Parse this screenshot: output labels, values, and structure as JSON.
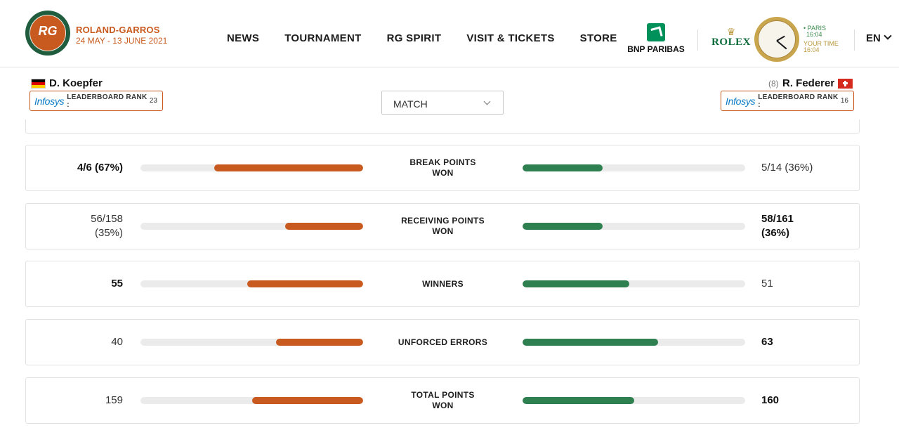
{
  "header": {
    "brand_name": "ROLAND-GARROS",
    "brand_dates": "24 MAY - 13 JUNE 2021",
    "logo_text": "RG",
    "nav": [
      "NEWS",
      "TOURNAMENT",
      "RG SPIRIT",
      "VISIT & TICKETS",
      "STORE"
    ],
    "sponsor_bnp": "BNP PARIBAS",
    "sponsor_rolex": "ROLEX",
    "clock": {
      "paris_label": "• PARIS",
      "paris_time": "16:04",
      "your_label": "YOUR TIME",
      "your_time": "16:04"
    },
    "language": "EN"
  },
  "players": {
    "left": {
      "name": "D. Koepfer",
      "flag": "germany-flag-icon",
      "rank_brand": "Infosys",
      "rank_label": "LEADERBOARD RANK :",
      "rank_value": "23"
    },
    "right": {
      "name": "R. Federer",
      "seed": "(8)",
      "flag": "switzerland-flag-icon",
      "rank_brand": "Infosys",
      "rank_label": "LEADERBOARD RANK :",
      "rank_value": "16"
    }
  },
  "selector": {
    "value": "MATCH"
  },
  "colors": {
    "left": "#c95a1f",
    "right": "#2e8050",
    "track": "#ebebeb"
  },
  "stats": [
    {
      "label_line1": "BREAK POINTS",
      "label_line2": "WON",
      "left_value": "4/6 (67%)",
      "left_line2": "",
      "right_value": "5/14 (36%)",
      "right_line2": "",
      "left_fill": 0.67,
      "right_fill": 0.36,
      "left_bold": true,
      "right_bold": false
    },
    {
      "label_line1": "RECEIVING POINTS",
      "label_line2": "WON",
      "left_value": "56/158",
      "left_line2": "(35%)",
      "right_value": "58/161",
      "right_line2": "(36%)",
      "left_fill": 0.35,
      "right_fill": 0.36,
      "left_bold": false,
      "right_bold": true
    },
    {
      "label_line1": "WINNERS",
      "label_line2": "",
      "left_value": "55",
      "left_line2": "",
      "right_value": "51",
      "right_line2": "",
      "left_fill": 0.52,
      "right_fill": 0.48,
      "left_bold": true,
      "right_bold": false
    },
    {
      "label_line1": "UNFORCED ERRORS",
      "label_line2": "",
      "left_value": "40",
      "left_line2": "",
      "right_value": "63",
      "right_line2": "",
      "left_fill": 0.39,
      "right_fill": 0.61,
      "left_bold": false,
      "right_bold": true
    },
    {
      "label_line1": "TOTAL POINTS",
      "label_line2": "WON",
      "left_value": "159",
      "left_line2": "",
      "right_value": "160",
      "right_line2": "",
      "left_fill": 0.5,
      "right_fill": 0.5,
      "left_bold": false,
      "right_bold": true
    }
  ]
}
